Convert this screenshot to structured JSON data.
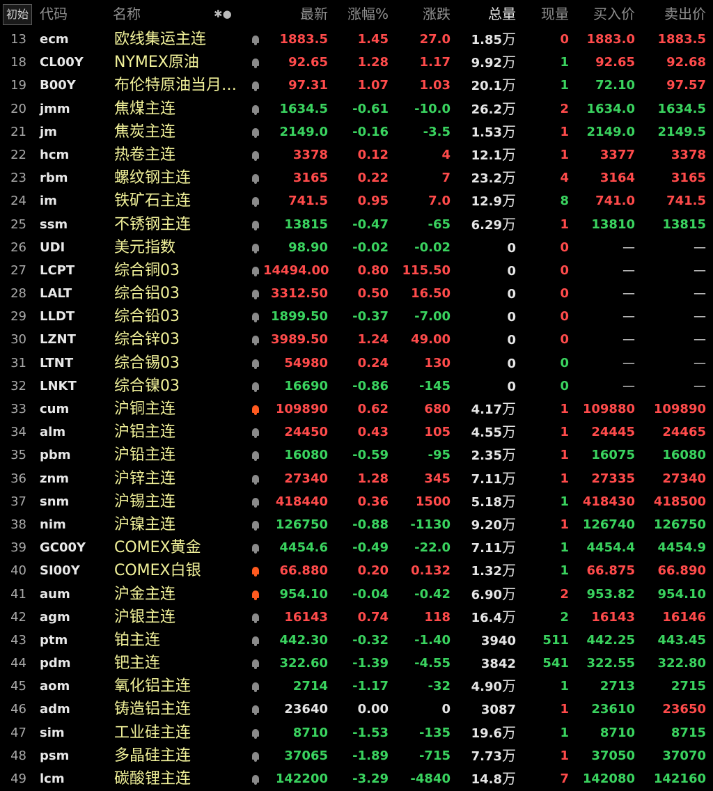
{
  "header": {
    "init_label": "初始",
    "code": "代码",
    "name": "名称",
    "star": "✱●",
    "last": "最新",
    "pct": "涨幅%",
    "chg": "涨跌",
    "vol": "总量",
    "cur": "现量",
    "bid": "买入价",
    "ask": "卖出价"
  },
  "colors": {
    "up": "#ff4b4b",
    "down": "#3ad35f",
    "flat": "#e6e6e6",
    "name": "#f2f29a",
    "alert": "#ff5a1f"
  },
  "rows": [
    {
      "idx": "13",
      "code": "ecm",
      "name": "欧线集运主连",
      "bell": "bell-icon",
      "alert": false,
      "last": "1883.5",
      "pct": "1.45",
      "chg": "27.0",
      "vol": "1.85",
      "unit": "万",
      "cur": "0",
      "bid": "1883.0",
      "ask": "1883.5",
      "dir": "up",
      "cur_dir": "up",
      "bid_dir": "up",
      "ask_dir": "up"
    },
    {
      "idx": "18",
      "code": "CL00Y",
      "name": "NYMEX原油",
      "bell": "bell-icon",
      "alert": false,
      "last": "92.65",
      "pct": "1.28",
      "chg": "1.17",
      "vol": "9.92",
      "unit": "万",
      "cur": "1",
      "bid": "92.65",
      "ask": "92.68",
      "dir": "up",
      "cur_dir": "down",
      "bid_dir": "up",
      "ask_dir": "up"
    },
    {
      "idx": "19",
      "code": "B00Y",
      "name": "布伦特原油当月连续",
      "bell": "bell-icon",
      "alert": false,
      "last": "97.31",
      "pct": "1.07",
      "chg": "1.03",
      "vol": "20.1",
      "unit": "万",
      "cur": "1",
      "bid": "72.10",
      "ask": "97.57",
      "dir": "up",
      "cur_dir": "down",
      "bid_dir": "down",
      "ask_dir": "up"
    },
    {
      "idx": "20",
      "code": "jmm",
      "name": "焦煤主连",
      "bell": "bell-icon",
      "alert": false,
      "last": "1634.5",
      "pct": "-0.61",
      "chg": "-10.0",
      "vol": "26.2",
      "unit": "万",
      "cur": "2",
      "bid": "1634.0",
      "ask": "1634.5",
      "dir": "down",
      "cur_dir": "up",
      "bid_dir": "down",
      "ask_dir": "down"
    },
    {
      "idx": "21",
      "code": "jm",
      "name": "焦炭主连",
      "bell": "bell-icon",
      "alert": false,
      "last": "2149.0",
      "pct": "-0.16",
      "chg": "-3.5",
      "vol": "1.53",
      "unit": "万",
      "cur": "1",
      "bid": "2149.0",
      "ask": "2149.5",
      "dir": "down",
      "cur_dir": "up",
      "bid_dir": "down",
      "ask_dir": "down"
    },
    {
      "idx": "22",
      "code": "hcm",
      "name": "热卷主连",
      "bell": "bell-icon",
      "alert": false,
      "last": "3378",
      "pct": "0.12",
      "chg": "4",
      "vol": "12.1",
      "unit": "万",
      "cur": "1",
      "bid": "3377",
      "ask": "3378",
      "dir": "up",
      "cur_dir": "up",
      "bid_dir": "up",
      "ask_dir": "up"
    },
    {
      "idx": "23",
      "code": "rbm",
      "name": "螺纹钢主连",
      "bell": "bell-icon",
      "alert": false,
      "last": "3165",
      "pct": "0.22",
      "chg": "7",
      "vol": "23.2",
      "unit": "万",
      "cur": "4",
      "bid": "3164",
      "ask": "3165",
      "dir": "up",
      "cur_dir": "up",
      "bid_dir": "up",
      "ask_dir": "up"
    },
    {
      "idx": "24",
      "code": "im",
      "name": "铁矿石主连",
      "bell": "bell-icon",
      "alert": false,
      "last": "741.5",
      "pct": "0.95",
      "chg": "7.0",
      "vol": "12.9",
      "unit": "万",
      "cur": "8",
      "bid": "741.0",
      "ask": "741.5",
      "dir": "up",
      "cur_dir": "down",
      "bid_dir": "up",
      "ask_dir": "up"
    },
    {
      "idx": "25",
      "code": "ssm",
      "name": "不锈钢主连",
      "bell": "bell-icon",
      "alert": false,
      "last": "13815",
      "pct": "-0.47",
      "chg": "-65",
      "vol": "6.29",
      "unit": "万",
      "cur": "1",
      "bid": "13810",
      "ask": "13815",
      "dir": "down",
      "cur_dir": "up",
      "bid_dir": "down",
      "ask_dir": "down"
    },
    {
      "idx": "26",
      "code": "UDI",
      "name": "美元指数",
      "bell": "bell-icon",
      "alert": false,
      "last": "98.90",
      "pct": "-0.02",
      "chg": "-0.02",
      "vol": "0",
      "unit": "",
      "cur": "0",
      "bid": "—",
      "ask": "—",
      "dir": "down",
      "cur_dir": "up",
      "bid_dir": "dash",
      "ask_dir": "dash"
    },
    {
      "idx": "27",
      "code": "LCPT",
      "name": "综合铜03",
      "bell": "bell-icon",
      "alert": false,
      "last": "14494.00",
      "pct": "0.80",
      "chg": "115.50",
      "vol": "0",
      "unit": "",
      "cur": "0",
      "bid": "—",
      "ask": "—",
      "dir": "up",
      "cur_dir": "up",
      "bid_dir": "dash",
      "ask_dir": "dash"
    },
    {
      "idx": "28",
      "code": "LALT",
      "name": "综合铝03",
      "bell": "bell-icon",
      "alert": false,
      "last": "3312.50",
      "pct": "0.50",
      "chg": "16.50",
      "vol": "0",
      "unit": "",
      "cur": "0",
      "bid": "—",
      "ask": "—",
      "dir": "up",
      "cur_dir": "up",
      "bid_dir": "dash",
      "ask_dir": "dash"
    },
    {
      "idx": "29",
      "code": "LLDT",
      "name": "综合铅03",
      "bell": "bell-icon",
      "alert": false,
      "last": "1899.50",
      "pct": "-0.37",
      "chg": "-7.00",
      "vol": "0",
      "unit": "",
      "cur": "0",
      "bid": "—",
      "ask": "—",
      "dir": "down",
      "cur_dir": "up",
      "bid_dir": "dash",
      "ask_dir": "dash"
    },
    {
      "idx": "30",
      "code": "LZNT",
      "name": "综合锌03",
      "bell": "bell-icon",
      "alert": false,
      "last": "3989.50",
      "pct": "1.24",
      "chg": "49.00",
      "vol": "0",
      "unit": "",
      "cur": "0",
      "bid": "—",
      "ask": "—",
      "dir": "up",
      "cur_dir": "up",
      "bid_dir": "dash",
      "ask_dir": "dash"
    },
    {
      "idx": "31",
      "code": "LTNT",
      "name": "综合锡03",
      "bell": "bell-icon",
      "alert": false,
      "last": "54980",
      "pct": "0.24",
      "chg": "130",
      "vol": "0",
      "unit": "",
      "cur": "0",
      "bid": "—",
      "ask": "—",
      "dir": "up",
      "cur_dir": "down",
      "bid_dir": "dash",
      "ask_dir": "dash"
    },
    {
      "idx": "32",
      "code": "LNKT",
      "name": "综合镍03",
      "bell": "bell-icon",
      "alert": false,
      "last": "16690",
      "pct": "-0.86",
      "chg": "-145",
      "vol": "0",
      "unit": "",
      "cur": "0",
      "bid": "—",
      "ask": "—",
      "dir": "down",
      "cur_dir": "down",
      "bid_dir": "dash",
      "ask_dir": "dash"
    },
    {
      "idx": "33",
      "code": "cum",
      "name": "沪铜主连",
      "bell": "bell-icon",
      "alert": true,
      "last": "109890",
      "pct": "0.62",
      "chg": "680",
      "vol": "4.17",
      "unit": "万",
      "cur": "1",
      "bid": "109880",
      "ask": "109890",
      "dir": "up",
      "cur_dir": "up",
      "bid_dir": "up",
      "ask_dir": "up"
    },
    {
      "idx": "34",
      "code": "alm",
      "name": "沪铝主连",
      "bell": "bell-icon",
      "alert": false,
      "last": "24450",
      "pct": "0.43",
      "chg": "105",
      "vol": "4.55",
      "unit": "万",
      "cur": "1",
      "bid": "24445",
      "ask": "24465",
      "dir": "up",
      "cur_dir": "up",
      "bid_dir": "up",
      "ask_dir": "up"
    },
    {
      "idx": "35",
      "code": "pbm",
      "name": "沪铅主连",
      "bell": "bell-icon",
      "alert": false,
      "last": "16080",
      "pct": "-0.59",
      "chg": "-95",
      "vol": "2.35",
      "unit": "万",
      "cur": "1",
      "bid": "16075",
      "ask": "16080",
      "dir": "down",
      "cur_dir": "up",
      "bid_dir": "down",
      "ask_dir": "down"
    },
    {
      "idx": "36",
      "code": "znm",
      "name": "沪锌主连",
      "bell": "bell-icon",
      "alert": false,
      "last": "27340",
      "pct": "1.28",
      "chg": "345",
      "vol": "7.11",
      "unit": "万",
      "cur": "1",
      "bid": "27335",
      "ask": "27340",
      "dir": "up",
      "cur_dir": "up",
      "bid_dir": "up",
      "ask_dir": "up"
    },
    {
      "idx": "37",
      "code": "snm",
      "name": "沪锡主连",
      "bell": "bell-icon",
      "alert": false,
      "last": "418440",
      "pct": "0.36",
      "chg": "1500",
      "vol": "5.18",
      "unit": "万",
      "cur": "1",
      "bid": "418430",
      "ask": "418500",
      "dir": "up",
      "cur_dir": "down",
      "bid_dir": "up",
      "ask_dir": "up"
    },
    {
      "idx": "38",
      "code": "nim",
      "name": "沪镍主连",
      "bell": "bell-icon",
      "alert": false,
      "last": "126750",
      "pct": "-0.88",
      "chg": "-1130",
      "vol": "9.20",
      "unit": "万",
      "cur": "1",
      "bid": "126740",
      "ask": "126750",
      "dir": "down",
      "cur_dir": "up",
      "bid_dir": "down",
      "ask_dir": "down"
    },
    {
      "idx": "39",
      "code": "GC00Y",
      "name": "COMEX黄金",
      "bell": "bell-icon",
      "alert": false,
      "last": "4454.6",
      "pct": "-0.49",
      "chg": "-22.0",
      "vol": "7.11",
      "unit": "万",
      "cur": "1",
      "bid": "4454.4",
      "ask": "4454.9",
      "dir": "down",
      "cur_dir": "down",
      "bid_dir": "down",
      "ask_dir": "down"
    },
    {
      "idx": "40",
      "code": "SI00Y",
      "name": "COMEX白银",
      "bell": "bell-icon",
      "alert": true,
      "last": "66.880",
      "pct": "0.20",
      "chg": "0.132",
      "vol": "1.32",
      "unit": "万",
      "cur": "1",
      "bid": "66.875",
      "ask": "66.890",
      "dir": "up",
      "cur_dir": "down",
      "bid_dir": "up",
      "ask_dir": "up"
    },
    {
      "idx": "41",
      "code": "aum",
      "name": "沪金主连",
      "bell": "bell-icon",
      "alert": true,
      "last": "954.10",
      "pct": "-0.04",
      "chg": "-0.42",
      "vol": "6.90",
      "unit": "万",
      "cur": "2",
      "bid": "953.82",
      "ask": "954.10",
      "dir": "down",
      "cur_dir": "up",
      "bid_dir": "down",
      "ask_dir": "down"
    },
    {
      "idx": "42",
      "code": "agm",
      "name": "沪银主连",
      "bell": "bell-icon",
      "alert": false,
      "last": "16143",
      "pct": "0.74",
      "chg": "118",
      "vol": "16.4",
      "unit": "万",
      "cur": "2",
      "bid": "16143",
      "ask": "16146",
      "dir": "up",
      "cur_dir": "down",
      "bid_dir": "up",
      "ask_dir": "up"
    },
    {
      "idx": "43",
      "code": "ptm",
      "name": "铂主连",
      "bell": "bell-icon",
      "alert": false,
      "last": "442.30",
      "pct": "-0.32",
      "chg": "-1.40",
      "vol": "3940",
      "unit": "",
      "cur": "511",
      "bid": "442.25",
      "ask": "443.45",
      "dir": "down",
      "cur_dir": "down",
      "bid_dir": "down",
      "ask_dir": "down"
    },
    {
      "idx": "44",
      "code": "pdm",
      "name": "钯主连",
      "bell": "bell-icon",
      "alert": false,
      "last": "322.60",
      "pct": "-1.39",
      "chg": "-4.55",
      "vol": "3842",
      "unit": "",
      "cur": "541",
      "bid": "322.55",
      "ask": "322.80",
      "dir": "down",
      "cur_dir": "down",
      "bid_dir": "down",
      "ask_dir": "down"
    },
    {
      "idx": "45",
      "code": "aom",
      "name": "氧化铝主连",
      "bell": "bell-icon",
      "alert": false,
      "last": "2714",
      "pct": "-1.17",
      "chg": "-32",
      "vol": "4.90",
      "unit": "万",
      "cur": "1",
      "bid": "2713",
      "ask": "2715",
      "dir": "down",
      "cur_dir": "down",
      "bid_dir": "down",
      "ask_dir": "down"
    },
    {
      "idx": "46",
      "code": "adm",
      "name": "铸造铝主连",
      "bell": "bell-icon",
      "alert": false,
      "last": "23640",
      "pct": "0.00",
      "chg": "0",
      "vol": "3087",
      "unit": "",
      "cur": "1",
      "bid": "23610",
      "ask": "23650",
      "dir": "flat",
      "cur_dir": "up",
      "bid_dir": "down",
      "ask_dir": "up"
    },
    {
      "idx": "47",
      "code": "sim",
      "name": "工业硅主连",
      "bell": "bell-icon",
      "alert": false,
      "last": "8710",
      "pct": "-1.53",
      "chg": "-135",
      "vol": "19.6",
      "unit": "万",
      "cur": "1",
      "bid": "8710",
      "ask": "8715",
      "dir": "down",
      "cur_dir": "down",
      "bid_dir": "down",
      "ask_dir": "down"
    },
    {
      "idx": "48",
      "code": "psm",
      "name": "多晶硅主连",
      "bell": "bell-icon",
      "alert": false,
      "last": "37065",
      "pct": "-1.89",
      "chg": "-715",
      "vol": "7.73",
      "unit": "万",
      "cur": "1",
      "bid": "37050",
      "ask": "37070",
      "dir": "down",
      "cur_dir": "up",
      "bid_dir": "down",
      "ask_dir": "down"
    },
    {
      "idx": "49",
      "code": "lcm",
      "name": "碳酸锂主连",
      "bell": "bell-icon",
      "alert": false,
      "last": "142200",
      "pct": "-3.29",
      "chg": "-4840",
      "vol": "14.8",
      "unit": "万",
      "cur": "7",
      "bid": "142080",
      "ask": "142160",
      "dir": "down",
      "cur_dir": "up",
      "bid_dir": "down",
      "ask_dir": "down"
    }
  ]
}
